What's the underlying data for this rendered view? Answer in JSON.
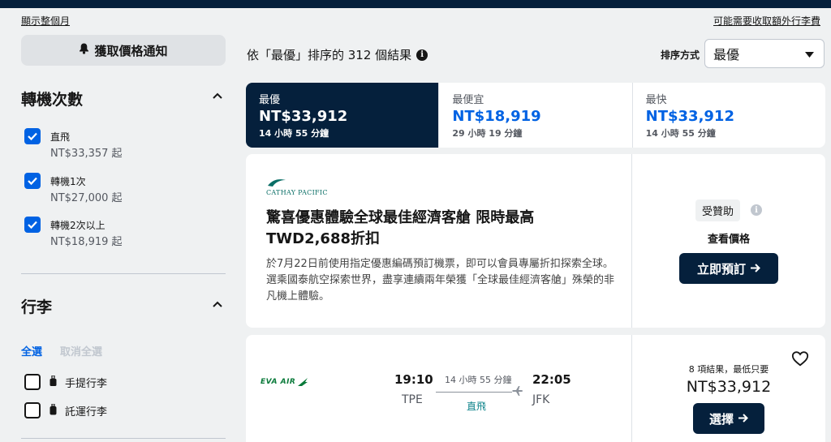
{
  "top": {
    "show_month": "顯示整個月",
    "baggage_fee_link": "可能需要收取額外行李費"
  },
  "sidebar": {
    "price_alert_label": "獲取價格通知",
    "stops": {
      "title": "轉機次數",
      "options": [
        {
          "label": "直飛",
          "price": "NT$33,357 起",
          "checked": true
        },
        {
          "label": "轉機1次",
          "price": "NT$27,000 起",
          "checked": true
        },
        {
          "label": "轉機2次以上",
          "price": "NT$18,919 起",
          "checked": true
        }
      ]
    },
    "baggage": {
      "title": "行李",
      "select_all": "全選",
      "deselect_all": "取消全選",
      "options": [
        {
          "label": "手提行李",
          "checked": false
        },
        {
          "label": "託運行李",
          "checked": false
        }
      ]
    }
  },
  "results": {
    "count_text": "依「最優」排序的 312 個結果",
    "sort_label": "排序方式",
    "sort_value": "最優"
  },
  "tabs": [
    {
      "label": "最優",
      "price": "NT$33,912",
      "duration": "14 小時 55 分鐘",
      "active": true
    },
    {
      "label": "最便宜",
      "price": "NT$18,919",
      "duration": "29 小時 19 分鐘",
      "active": false
    },
    {
      "label": "最快",
      "price": "NT$33,912",
      "duration": "14 小時 55 分鐘",
      "active": false
    }
  ],
  "ad": {
    "brand": "CATHAY PACIFIC",
    "headline": "驚喜優惠體驗全球最佳經濟客艙 限時最高TWD2,688折扣",
    "body": "於7月22日前使用指定優惠編碼預訂機票，即可以會員專屬折扣探索全球。選乘國泰航空探索世界，盡享連續兩年榮獲「全球最佳經濟客艙」殊榮的非凡機上體驗。",
    "sponsored_label": "受贊助",
    "view_price": "查看價格",
    "book_label": "立即預訂"
  },
  "flight": {
    "airline": "EVA AIR",
    "dep_time": "19:10",
    "dep_code": "TPE",
    "duration": "14 小時 55 分鐘",
    "stops": "直飛",
    "arr_time": "22:05",
    "arr_code": "JFK",
    "deals_text": "8 項結果，最低只要",
    "price": "NT$33,912",
    "select_label": "選擇"
  },
  "colors": {
    "navy": "#05203c",
    "accent_blue": "#0062e3",
    "background": "#eff1f2",
    "direct_teal": "#0c838a"
  },
  "icons": {
    "alert": "bell-icon",
    "info": "info-icon",
    "sort_arrow": "caret-down-icon",
    "collapse": "chevron-up-icon",
    "checkbox": "checkmark-icon",
    "cabin_bag": "cabin-bag-icon",
    "checked_bag": "checked-bag-icon",
    "arrow": "arrow-right-icon",
    "plane": "plane-icon",
    "favorite": "heart-icon"
  }
}
